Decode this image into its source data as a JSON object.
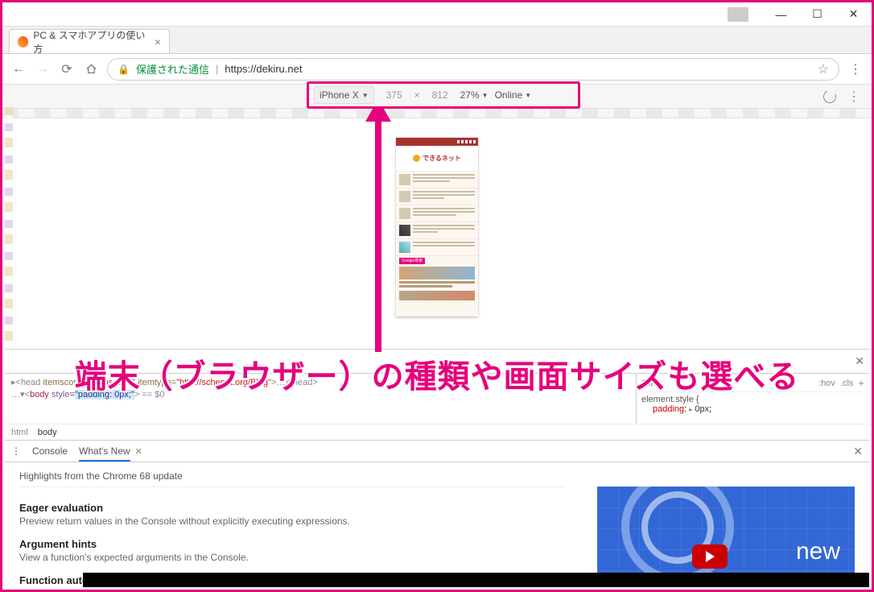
{
  "window": {
    "tab_title": "PC & スマホアプリの使い方",
    "minimize": "—",
    "maximize": "☐",
    "close": "✕"
  },
  "addressbar": {
    "back": "←",
    "forward": "→",
    "reload": "⟳",
    "secure_label": "保護された通信",
    "url": "https://dekiru.net",
    "star": "☆",
    "menu": "⋮"
  },
  "device_toolbar": {
    "device": "iPhone X",
    "width": "375",
    "x": "×",
    "height": "812",
    "zoom": "27%",
    "network": "Online",
    "right_menu": "⋮"
  },
  "phone": {
    "logo_text": "できるネット",
    "tag": "Google検索",
    "article": "Google画像検索で色やサイズなどの条件を設定して検索する方法"
  },
  "annotation": "端末（ブラウザー）の種類や画面サイズも選べる",
  "elements_panel": {
    "line1_a": "▸<head ",
    "line1_b": "itemscope",
    "line1_c": " itemtype=",
    "line1_d": "\"http://schema.org/Blog\"",
    "line1_e": ">…</head>",
    "line2_a": "…▾<",
    "line2_tag": "body",
    "line2_b": " ",
    "line2_attr": "style",
    "line2_c": "=",
    "line2_val": "\"padding: 0px;\"",
    "line2_d": "> == $0",
    "breadcrumb_html": "html",
    "breadcrumb_body": "body"
  },
  "styles_panel": {
    "filter": "Filter",
    "hov": ":hov",
    "cls": ".cls",
    "plus": "+",
    "selector": "element.style {",
    "prop": "padding",
    "val": "0px",
    "semi": ";"
  },
  "drawer": {
    "tab_console": "Console",
    "tab_whatsnew": "What's New",
    "headline": "Highlights from the Chrome 68 update",
    "items": [
      {
        "title": "Eager evaluation",
        "desc": "Preview return values in the Console without explicitly executing expressions."
      },
      {
        "title": "Argument hints",
        "desc": "View a function's expected arguments in the Console."
      },
      {
        "title": "Function autocompletion",
        "desc": ""
      }
    ],
    "video_text": "new"
  }
}
